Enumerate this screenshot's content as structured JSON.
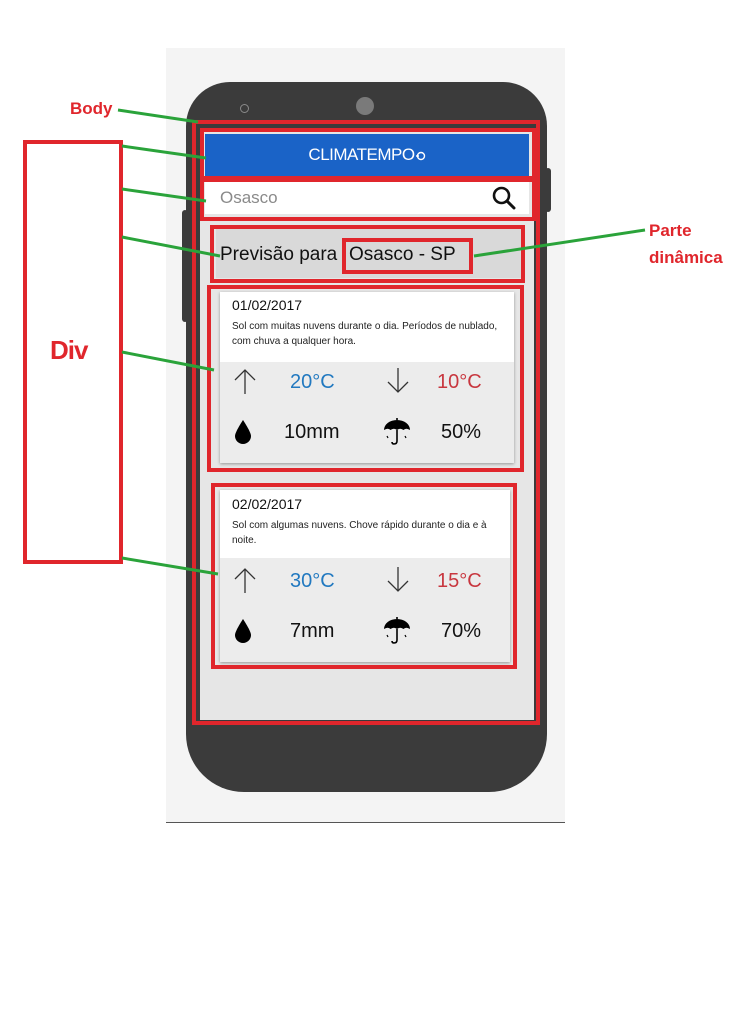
{
  "app": {
    "title": "CLIMATEMPO"
  },
  "search": {
    "value": "Osasco"
  },
  "heading": {
    "static_text": "Previsão para",
    "dynamic_text": "Osasco - SP"
  },
  "forecasts": [
    {
      "date": "01/02/2017",
      "description": "Sol com muitas nuvens durante o dia. Períodos de nublado, com chuva a qualquer hora.",
      "max": "20°C",
      "min": "10°C",
      "rain": "10mm",
      "rain_chance": "50%"
    },
    {
      "date": "02/02/2017",
      "description": "Sol com algumas nuvens. Chove rápido durante o dia e à noite.",
      "max": "30°C",
      "min": "15°C",
      "rain": "7mm",
      "rain_chance": "70%"
    }
  ],
  "annotations": {
    "body_label": "Body",
    "div_label": "Div",
    "dynamic_label": "Parte dinâmica"
  },
  "colors": {
    "header": "#1a63c7",
    "max_temp": "#2279c0",
    "min_temp": "#c8373f",
    "annotation_box": "#e0262c",
    "annotation_line": "#2aa33a"
  },
  "icons": [
    "search-icon",
    "arrow-up-icon",
    "arrow-down-icon",
    "drop-icon",
    "umbrella-icon",
    "climatempo-logo-icon"
  ]
}
